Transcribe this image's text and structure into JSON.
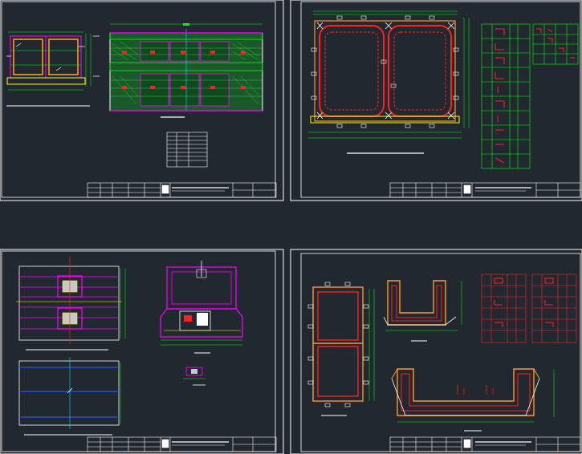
{
  "app": {
    "background": "#212830",
    "border_color": "#ffffff"
  },
  "colors": {
    "white": "#ffffff",
    "yellow": "#ffff00",
    "green": "#00ff00",
    "magenta": "#ff00ff",
    "red": "#ff2020",
    "orange": "#ff9a20",
    "blue": "#2050ff",
    "cyan": "#00e0ff"
  },
  "sheets": [
    {
      "id": "sheet-1",
      "content": [
        "box-culvert-section",
        "reinforcement-plan",
        "material-table"
      ]
    },
    {
      "id": "sheet-2",
      "content": [
        "double-cell-reinforcement",
        "rebar-detail-table"
      ]
    },
    {
      "id": "sheet-3",
      "content": [
        "plan-view",
        "cross-section",
        "detail"
      ]
    },
    {
      "id": "sheet-4",
      "content": [
        "single-cell-detail",
        "u-channel-section",
        "wide-channel-section",
        "rebar-tables"
      ]
    }
  ]
}
